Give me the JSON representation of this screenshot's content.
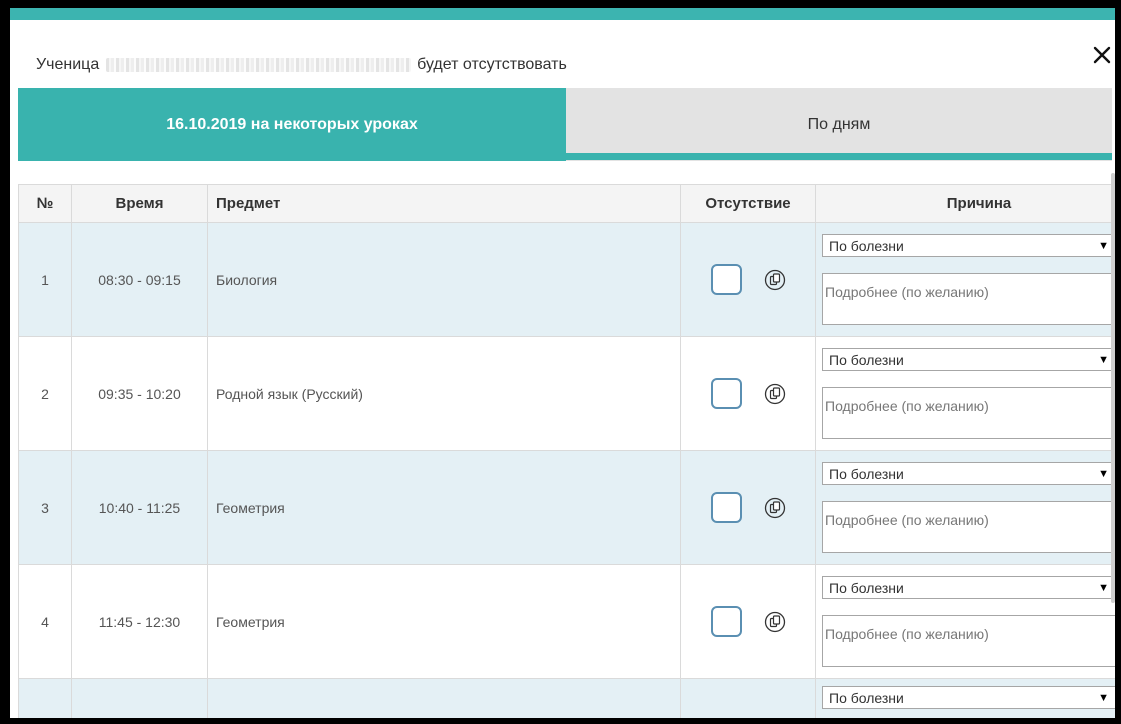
{
  "header": {
    "prefix": "Ученица",
    "suffix": "будет отсутствовать"
  },
  "tabs": [
    {
      "label": "16.10.2019 на некоторых уроках",
      "active": true
    },
    {
      "label": "По дням",
      "active": false
    }
  ],
  "table": {
    "headers": {
      "num": "№",
      "time": "Время",
      "subject": "Предмет",
      "absence": "Отсутствие",
      "reason": "Причина"
    },
    "rows": [
      {
        "num": "1",
        "time": "08:30 - 09:15",
        "subject": "Биология",
        "reason": "По болезни",
        "details_placeholder": "Подробнее (по желанию)"
      },
      {
        "num": "2",
        "time": "09:35 - 10:20",
        "subject": "Родной язык (Русский)",
        "reason": "По болезни",
        "details_placeholder": "Подробнее (по желанию)"
      },
      {
        "num": "3",
        "time": "10:40 - 11:25",
        "subject": "Геометрия",
        "reason": "По болезни",
        "details_placeholder": "Подробнее (по желанию)"
      },
      {
        "num": "4",
        "time": "11:45 - 12:30",
        "subject": "Геометрия",
        "reason": "По болезни",
        "details_placeholder": "Подробнее (по желанию)"
      },
      {
        "num": "",
        "time": "",
        "subject": "",
        "reason": "По болезни",
        "details_placeholder": ""
      }
    ]
  },
  "icons": {
    "close": "close-icon",
    "copy": "copy-icon",
    "dropdown": "chevron-down-icon",
    "resize": "resize-handle-icon"
  },
  "colors": {
    "accent": "#39b3ae",
    "row_highlight": "#e4f0f5",
    "inactive_tab": "#e3e3e3",
    "checkbox_border": "#5a8fb2"
  }
}
